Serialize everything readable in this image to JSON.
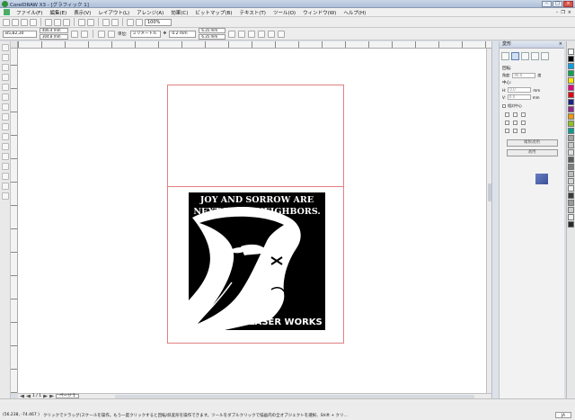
{
  "window": {
    "title": "CorelDRAW X3 - [グラフィック 1]"
  },
  "menu": [
    "ファイル(F)",
    "編集(E)",
    "表示(V)",
    "レイアウト(L)",
    "アレンジ(A)",
    "効果(C)",
    "ビットマップ(B)",
    "テキスト(T)",
    "ツール(O)",
    "ウィンドウ(W)",
    "ヘルプ(H)"
  ],
  "toolbar": {
    "zoom": "100%"
  },
  "property_bar": {
    "paper": "B5,B2,30",
    "width": "406.4 mm",
    "height": "304.8 mm",
    "units_label": "単位:",
    "units": "ミリメートル",
    "nudge": "0.2 mm",
    "dup_x": "6.35 mm",
    "dup_y": "6.35 mm"
  },
  "artwork": {
    "headline_1": "JOY AND SORROW ARE",
    "headline_2": "NEXT DOOR NEIGHBORS.",
    "brand": "LASER WORKS"
  },
  "page_nav": {
    "counter": "1 / 1",
    "tab": "ページ 1"
  },
  "docker": {
    "title": "変形",
    "rotation_label": "回転:",
    "angle_label": "角度:",
    "angle_value": "90.0",
    "angle_unit": "度",
    "center_label": "中心:",
    "h_prefix": "H:",
    "h_value": "0.0",
    "v_prefix": "V:",
    "v_value": "0.0",
    "unit_mm": "mm",
    "relative_label": "相対中心",
    "apply_copy_label": "複製適用",
    "apply_label": "適用"
  },
  "palette_colors": [
    "#ffffff",
    "#000000",
    "#00a0e9",
    "#00a651",
    "#ffe600",
    "#e4007f",
    "#e60012",
    "#1d2088",
    "#92278f",
    "#f39800",
    "#8fc31f",
    "#009e96",
    "#a3a3a3",
    "#c8c8c8",
    "#e0e0e0",
    "#5a5a5a",
    "#7f7f7f",
    "#bdbdbd",
    "#d6d6d6",
    "#f2f2f2",
    "#3c3c3c",
    "#9a9a9a",
    "#cccccc",
    "#eeeeee",
    "#2a2a2a"
  ],
  "status": {
    "coords": "(56.238, -74.467 )",
    "hint": "クリックでドラッグ(スケールを操作。もう一度クリックすると回転/斜変形を操作できます。ツールをダブルクリックで描画内の全オブジェクトを選択、Shift + クリ…",
    "lang": "JA"
  }
}
